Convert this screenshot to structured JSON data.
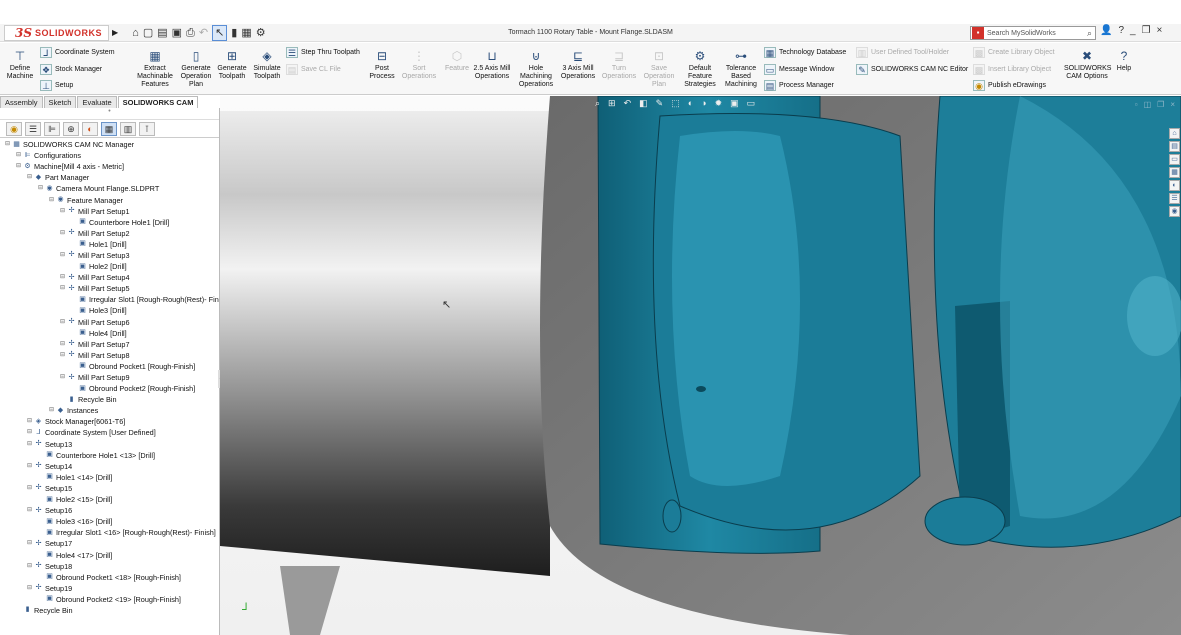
{
  "window": {
    "logo": "SOLIDWORKS",
    "document_title": "Tormach 1100 Rotary Table - Mount Flange.SLDASM",
    "search_placeholder": "Search MySolidWorks"
  },
  "ribbon": {
    "define_machine": "Define Machine",
    "coordinate_system": "Coordinate System",
    "stock_manager": "Stock Manager",
    "setup": "Setup",
    "extract_features": "Extract Machinable Features",
    "generate_plan": "Generate Operation Plan",
    "generate_toolpath": "Generate Toolpath",
    "simulate_toolpath": "Simulate Toolpath",
    "step_thru": "Step Thru Toolpath",
    "save_cl": "Save CL File",
    "post_process": "Post Process",
    "sort_operations": "Sort Operations",
    "feature": "Feature",
    "mill_25": "2.5 Axis Mill Operations",
    "hole_machining": "Hole Machining Operations",
    "mill_3": "3 Axis Mill Operations",
    "turn_operations": "Turn Operations",
    "save_plan": "Save Operation Plan",
    "default_strategies": "Default Feature Strategies",
    "tolerance": "Tolerance Based Machining",
    "tech_db": "Technology Database",
    "message_window": "Message Window",
    "process_manager": "Process Manager",
    "user_tool": "User Defined Tool/Holder",
    "nc_editor": "SOLIDWORKS CAM NC Editor",
    "create_library": "Create Library Object",
    "insert_library": "Insert Library Object",
    "publish": "Publish eDrawings",
    "cam_options": "SOLIDWORKS CAM Options",
    "help": "Help"
  },
  "tabs": [
    "Assembly",
    "Sketch",
    "Evaluate",
    "SOLIDWORKS CAM"
  ],
  "tree": [
    {
      "label": "SOLIDWORKS CAM NC Manager",
      "level": 0,
      "icon": "manager"
    },
    {
      "label": "Configurations",
      "level": 1,
      "icon": "config"
    },
    {
      "label": "Machine[Mill 4 axis - Metric]",
      "level": 1,
      "icon": "machine"
    },
    {
      "label": "Part Manager",
      "level": 2,
      "icon": "part-manager"
    },
    {
      "label": "Camera Mount Flange.SLDPRT",
      "level": 3,
      "icon": "part"
    },
    {
      "label": "Feature Manager",
      "level": 4,
      "icon": "feature-manager"
    },
    {
      "label": "Mill Part Setup1",
      "level": 5,
      "icon": "setup"
    },
    {
      "label": "Counterbore Hole1 [Drill]",
      "level": 6,
      "icon": "feature"
    },
    {
      "label": "Mill Part Setup2",
      "level": 5,
      "icon": "setup"
    },
    {
      "label": "Hole1 [Drill]",
      "level": 6,
      "icon": "feature"
    },
    {
      "label": "Mill Part Setup3",
      "level": 5,
      "icon": "setup"
    },
    {
      "label": "Hole2 [Drill]",
      "level": 6,
      "icon": "feature"
    },
    {
      "label": "Mill Part Setup4",
      "level": 5,
      "icon": "setup"
    },
    {
      "label": "Mill Part Setup5",
      "level": 5,
      "icon": "setup"
    },
    {
      "label": "Irregular Slot1 [Rough-Rough(Rest)- Fin",
      "level": 6,
      "icon": "feature"
    },
    {
      "label": "Hole3 [Drill]",
      "level": 6,
      "icon": "feature"
    },
    {
      "label": "Mill Part Setup6",
      "level": 5,
      "icon": "setup"
    },
    {
      "label": "Hole4 [Drill]",
      "level": 6,
      "icon": "feature"
    },
    {
      "label": "Mill Part Setup7",
      "level": 5,
      "icon": "setup"
    },
    {
      "label": "Mill Part Setup8",
      "level": 5,
      "icon": "setup"
    },
    {
      "label": "Obround Pocket1 [Rough-Finish]",
      "level": 6,
      "icon": "feature"
    },
    {
      "label": "Mill Part Setup9",
      "level": 5,
      "icon": "setup"
    },
    {
      "label": "Obround Pocket2 [Rough-Finish]",
      "level": 6,
      "icon": "feature"
    },
    {
      "label": "Recycle Bin",
      "level": 5,
      "icon": "recycle"
    },
    {
      "label": "Instances",
      "level": 4,
      "icon": "instances"
    },
    {
      "label": "Stock Manager[6061-T6]",
      "level": 2,
      "icon": "stock"
    },
    {
      "label": "Coordinate System [User Defined]",
      "level": 2,
      "icon": "coord"
    },
    {
      "label": "Setup13",
      "level": 2,
      "icon": "setup"
    },
    {
      "label": "Counterbore Hole1 <13> [Drill]",
      "level": 3,
      "icon": "feature"
    },
    {
      "label": "Setup14",
      "level": 2,
      "icon": "setup"
    },
    {
      "label": "Hole1 <14> [Drill]",
      "level": 3,
      "icon": "feature"
    },
    {
      "label": "Setup15",
      "level": 2,
      "icon": "setup"
    },
    {
      "label": "Hole2 <15> [Drill]",
      "level": 3,
      "icon": "feature"
    },
    {
      "label": "Setup16",
      "level": 2,
      "icon": "setup"
    },
    {
      "label": "Hole3 <16> [Drill]",
      "level": 3,
      "icon": "feature"
    },
    {
      "label": "Irregular Slot1 <16> [Rough-Rough(Rest)- Finish]",
      "level": 3,
      "icon": "feature"
    },
    {
      "label": "Setup17",
      "level": 2,
      "icon": "setup"
    },
    {
      "label": "Hole4 <17> [Drill]",
      "level": 3,
      "icon": "feature"
    },
    {
      "label": "Setup18",
      "level": 2,
      "icon": "setup"
    },
    {
      "label": "Obround Pocket1 <18> [Rough-Finish]",
      "level": 3,
      "icon": "feature"
    },
    {
      "label": "Setup19",
      "level": 2,
      "icon": "setup"
    },
    {
      "label": "Obround Pocket2 <19> [Rough-Finish]",
      "level": 3,
      "icon": "feature"
    },
    {
      "label": "Recycle Bin",
      "level": 1,
      "icon": "recycle"
    }
  ],
  "colors": {
    "model_teal": "#1d7e99",
    "flange_gray": "#8a8a8a",
    "logo_red": "#d2322b"
  }
}
